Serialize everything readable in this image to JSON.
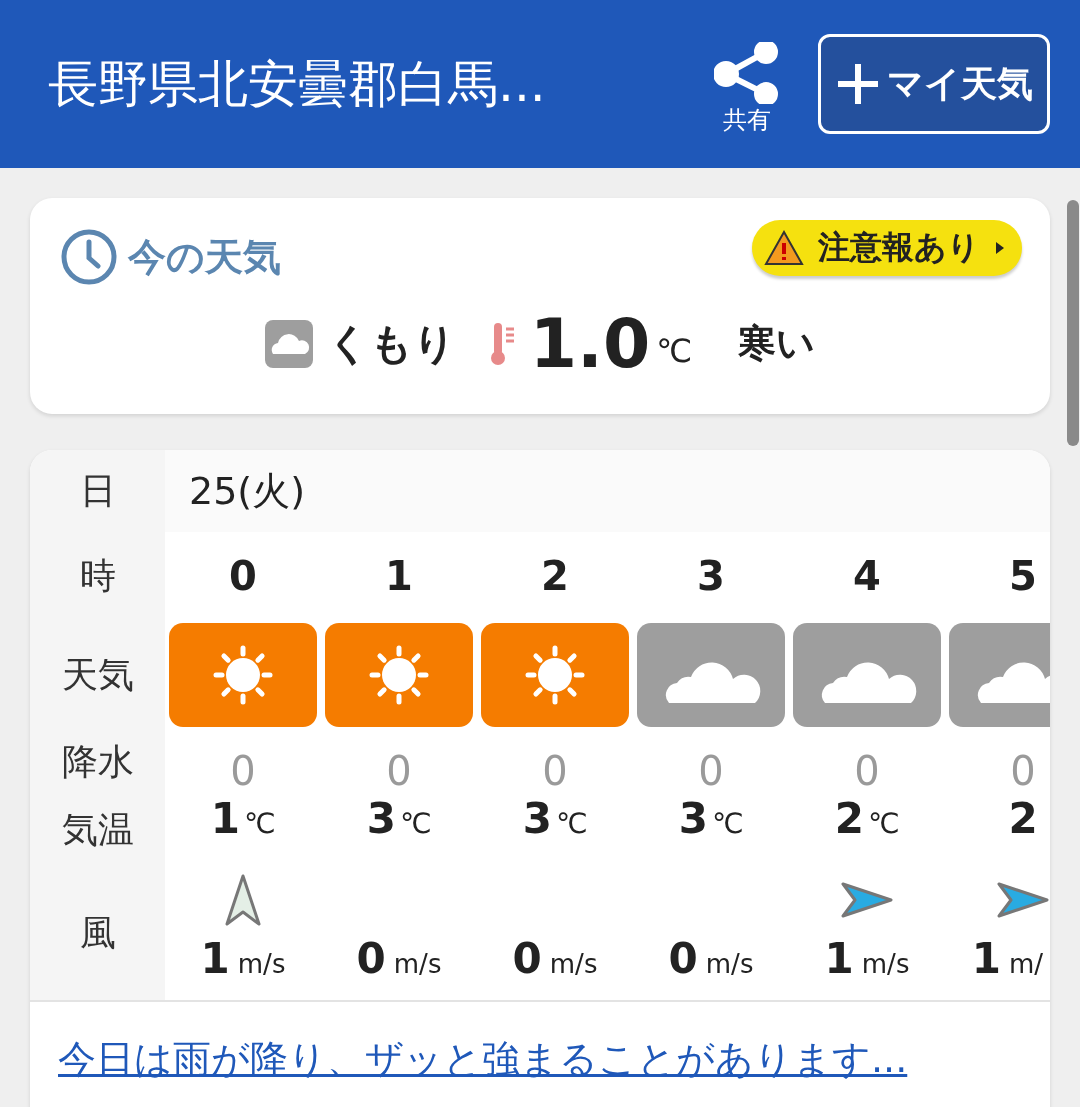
{
  "header": {
    "title": "長野県北安曇郡白馬...",
    "share_label": "共有",
    "my_weather_button": "マイ天気"
  },
  "current": {
    "title": "今の天気",
    "alert_badge": "注意報あり",
    "condition": "くもり",
    "temperature": "1.0",
    "temperature_unit": "℃",
    "feeling": "寒い"
  },
  "hourly": {
    "labels": {
      "date": "日",
      "hour": "時",
      "weather": "天気",
      "precip": "降水",
      "temp": "気温",
      "wind": "風"
    },
    "date": "25(火)",
    "hours": [
      {
        "hour": "0",
        "kind": "sunny",
        "precip": "0",
        "temp": "1",
        "temp_unit": "℃",
        "wind": {
          "kind": "north",
          "speed": "1",
          "unit": "m/s"
        }
      },
      {
        "hour": "1",
        "kind": "sunny",
        "precip": "0",
        "temp": "3",
        "temp_unit": "℃",
        "wind": {
          "kind": "calm",
          "speed": "0",
          "unit": "m/s"
        }
      },
      {
        "hour": "2",
        "kind": "sunny",
        "precip": "0",
        "temp": "3",
        "temp_unit": "℃",
        "wind": {
          "kind": "calm",
          "speed": "0",
          "unit": "m/s"
        }
      },
      {
        "hour": "3",
        "kind": "cloudy",
        "precip": "0",
        "temp": "3",
        "temp_unit": "℃",
        "wind": {
          "kind": "calm",
          "speed": "0",
          "unit": "m/s"
        }
      },
      {
        "hour": "4",
        "kind": "cloudy",
        "precip": "0",
        "temp": "2",
        "temp_unit": "℃",
        "wind": {
          "kind": "east",
          "speed": "1",
          "unit": "m/s"
        }
      },
      {
        "hour": "5",
        "kind": "cloudy",
        "precip": "0",
        "temp": "2",
        "wind": {
          "kind": "east",
          "speed": "1",
          "unit": "m/"
        }
      }
    ]
  },
  "forecast_link": "今日は雨が降り、ザッと強まることがあります..."
}
